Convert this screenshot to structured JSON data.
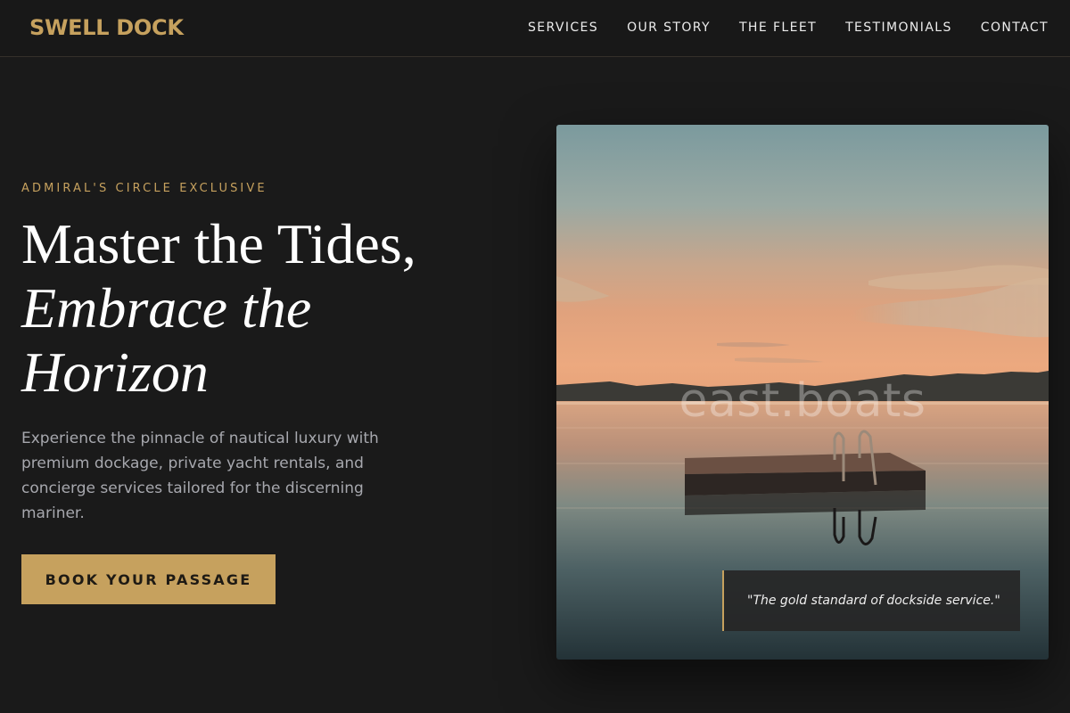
{
  "brand": {
    "name": "SWELL DOCK",
    "accent_color": "#c6a15e",
    "background_color": "#1a1a1a"
  },
  "nav": {
    "items": [
      {
        "label": "SERVICES"
      },
      {
        "label": "OUR STORY"
      },
      {
        "label": "THE FLEET"
      },
      {
        "label": "TESTIMONIALS"
      },
      {
        "label": "CONTACT"
      }
    ]
  },
  "hero": {
    "eyebrow": "ADMIRAL'S CIRCLE EXCLUSIVE",
    "headline_line1": "Master the Tides,",
    "headline_line2": "Embrace the",
    "headline_line3": "Horizon",
    "description": "Experience the pinnacle of nautical luxury with premium dockage, private yacht rentals, and concierge services tailored for the discerning mariner.",
    "cta_label": "BOOK YOUR PASSAGE"
  },
  "image": {
    "watermark": "east.boats",
    "quote": "\"The gold standard of dockside service.\"",
    "scene": "floating-dock-lake-sunset"
  }
}
